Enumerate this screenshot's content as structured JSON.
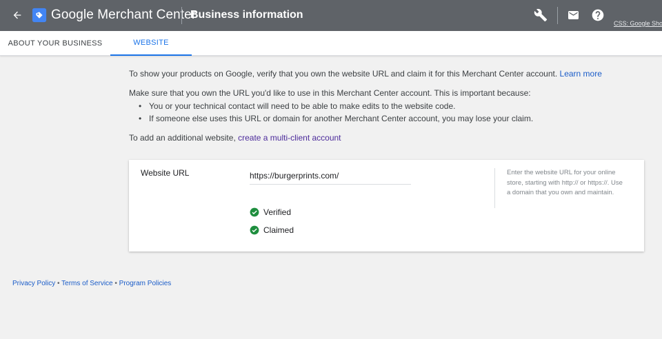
{
  "header": {
    "brand": "Google Merchant Center",
    "title": "Business information",
    "account": "CSS: Google Shopp",
    "icons": {
      "back": "arrow-back-icon",
      "wrench": "wrench-icon",
      "mail": "mail-icon",
      "help": "help-icon"
    }
  },
  "tabs": [
    {
      "label": "ABOUT YOUR BUSINESS",
      "active": false
    },
    {
      "label": "WEBSITE",
      "active": true
    }
  ],
  "content": {
    "intro_text": "To show your products on Google, verify that you own the website URL and claim it for this Merchant Center account. ",
    "learn_more": "Learn more",
    "ownership_text": "Make sure that you own the URL you'd like to use in this Merchant Center account. This is important because:",
    "bullets": [
      "You or your technical contact will need to be able to make edits to the website code.",
      "If someone else uses this URL or domain for another Merchant Center account, you may lose your claim."
    ],
    "additional_text": "To add an additional website, ",
    "multi_client_link": "create a multi-client account"
  },
  "card": {
    "label": "Website URL",
    "url_value": "https://burgerprints.com/",
    "statuses": [
      {
        "label": "Verified",
        "icon": "check-circle-icon"
      },
      {
        "label": "Claimed",
        "icon": "check-circle-icon"
      }
    ],
    "help_text": "Enter the website URL for your online store, starting with http:// or https://. Use a domain that you own and maintain."
  },
  "footer": {
    "privacy": "Privacy Policy",
    "sep1": " • ",
    "terms": "Terms of Service",
    "sep2": " • ",
    "program": "Program Policies"
  },
  "colors": {
    "topbar": "#5f6368",
    "accent": "#1a73e8",
    "link": "#1a5cc8",
    "success": "#1e8e3e"
  }
}
